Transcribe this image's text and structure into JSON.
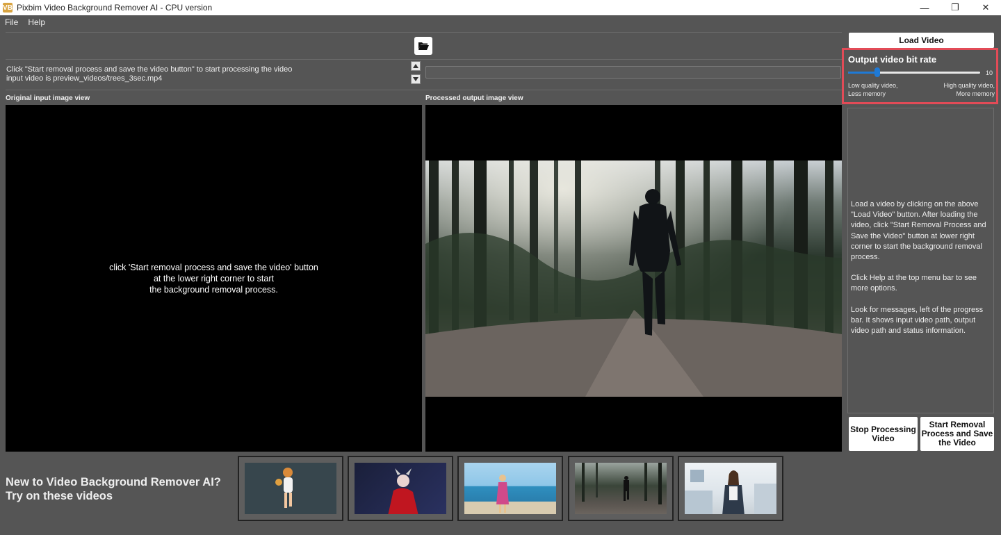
{
  "window": {
    "title": "Pixbim Video Background Remover AI - CPU version",
    "logo_text": "VB",
    "controls": {
      "minimize": "—",
      "maximize": "❐",
      "close": "✕"
    }
  },
  "menu": {
    "items": [
      "File",
      "Help"
    ]
  },
  "toolbar": {
    "folder_icon": "folder-open-icon"
  },
  "messages": {
    "line1": "Click \"Start removal process and save the video button\" to start processing the video",
    "line2": "input video is preview_videos/trees_3sec.mp4"
  },
  "views": {
    "input_label": "Original input image view",
    "output_label": "Processed output image view",
    "input_msg_line1": "click 'Start removal process and save the video' button",
    "input_msg_line2": "at the lower right corner to start",
    "input_msg_line3": "the background removal process."
  },
  "right_panel": {
    "load_video": "Load Video",
    "bitrate": {
      "title": "Output video bit rate",
      "value": "10",
      "level_fraction": 0.22,
      "low_line1": "Low quality video,",
      "low_line2": "Less memory",
      "high_line1": "High quality video,",
      "high_line2": "More memory"
    },
    "info": {
      "p1": "Load a video by clicking on the above \"Load Video\" button. After loading the video, click \"Start Removal Process and Save the Video\" button at lower right corner to start the background removal process.",
      "p2": "Click Help at the top menu bar to see more options.",
      "p3": "Look for messages, left of the progress bar. It shows input video path, output video path and status information."
    },
    "stop_btn": "Stop Processing Video",
    "start_btn": "Start Removal Process and Save the Video"
  },
  "promo": {
    "line1": "New to Video Background Remover AI?",
    "line2": "Try on these videos"
  },
  "colors": {
    "background": "#555555",
    "highlight_border": "#e24b57",
    "slider_accent": "#1f7ad6"
  }
}
